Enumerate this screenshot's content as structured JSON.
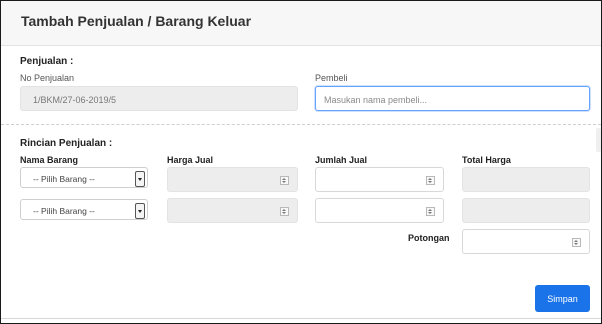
{
  "header": {
    "title": "Tambah Penjualan / Barang Keluar"
  },
  "penjualan": {
    "section_title": "Penjualan :",
    "no_label": "No Penjualan",
    "no_value": "1/BKM/27-06-2019/5",
    "pembeli_label": "Pembeli",
    "pembeli_placeholder": "Masukan nama pembeli..."
  },
  "rincian": {
    "section_title": "Rincian Penjualan :",
    "columns": [
      "Nama Barang",
      "Harga Jual",
      "Jumlah Jual",
      "Total Harga"
    ],
    "rows": [
      {
        "select_value": "-- Pilih Barang --"
      },
      {
        "select_value": "-- Pilih Barang --"
      }
    ],
    "potongan_label": "Potongan"
  },
  "actions": {
    "save_label": "Simpan"
  }
}
